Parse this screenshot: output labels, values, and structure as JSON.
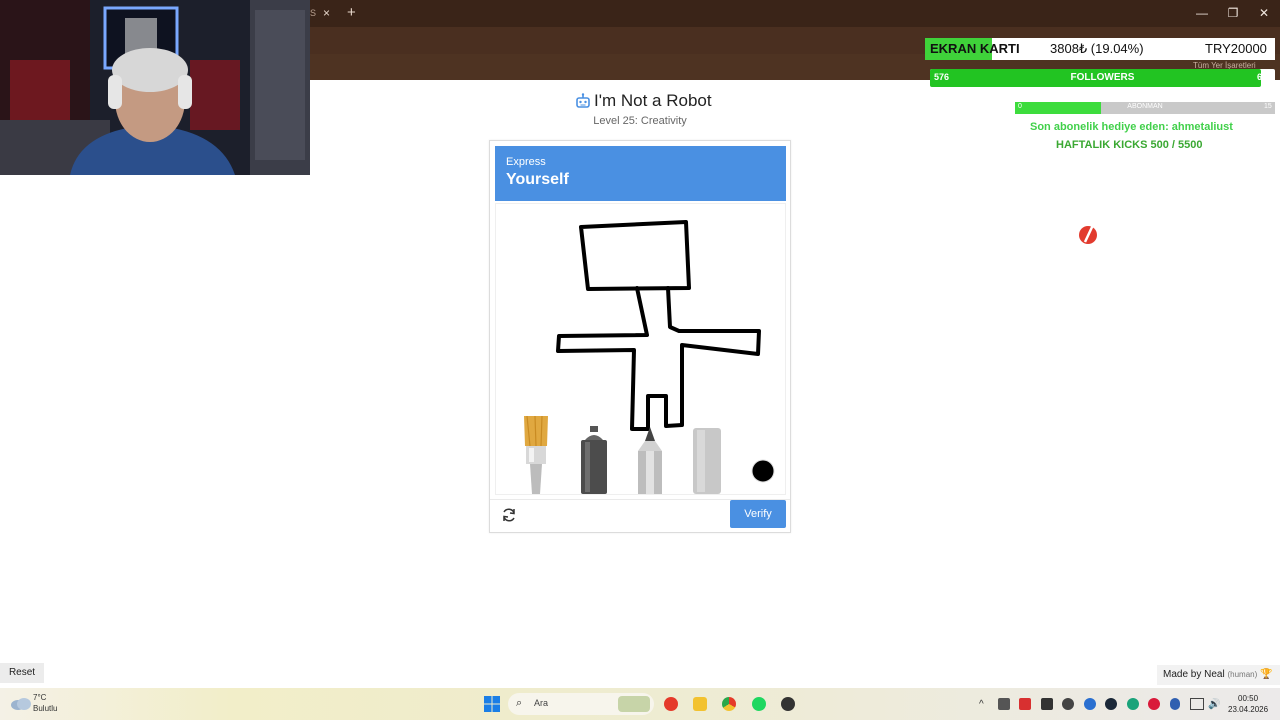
{
  "browser": {
    "tab_partial": "S",
    "tab_close": "×",
    "new_tab": "+",
    "window_controls": [
      "—",
      "❐",
      "✕"
    ],
    "bookmarks_label": "Tüm Yer İşaretleri"
  },
  "overlay": {
    "gpu_label": "EKRAN KARTI",
    "gpu_progress": "3808₺ (19.04%)",
    "gpu_fraction": 0.1904,
    "gpu_goal": "TRY20000",
    "followers_current": "576",
    "followers_label": "FOLLOWERS",
    "followers_goal": "600",
    "followers_fraction": 0.96,
    "subs_left": "0",
    "subs_label": "ABONMAN",
    "subs_right": "15",
    "subs_fraction": 0.33,
    "last_gift": "Son abonelik hediye eden: ahmetaliust",
    "weekly_kicks": "HAFTALIK KICKS 500 / 5500",
    "colors": {
      "accent_green": "#3fd23a",
      "text_green": "#41d04a"
    }
  },
  "page": {
    "robot_icon": "robot-icon",
    "title": "I'm Not a Robot",
    "subtitle": "Level 25: Creativity",
    "captcha": {
      "header_small": "Express",
      "header_big": "Yourself",
      "tools": [
        "paint-brush-icon",
        "spray-can-icon",
        "pencil-icon",
        "eraser-icon",
        "color-picker-black"
      ],
      "selected_color": "#000000",
      "verify_label": "Verify",
      "refresh_icon": "refresh-icon",
      "header_color": "#4a90e2"
    },
    "reset_label": "Reset",
    "made_by": "Made by Neal",
    "made_by_note": "(human)"
  },
  "taskbar": {
    "weather_temp": "7°C",
    "weather_desc": "Bulutlu",
    "search_placeholder": "Ara",
    "time": "00:50",
    "date": "23.04.2026"
  }
}
